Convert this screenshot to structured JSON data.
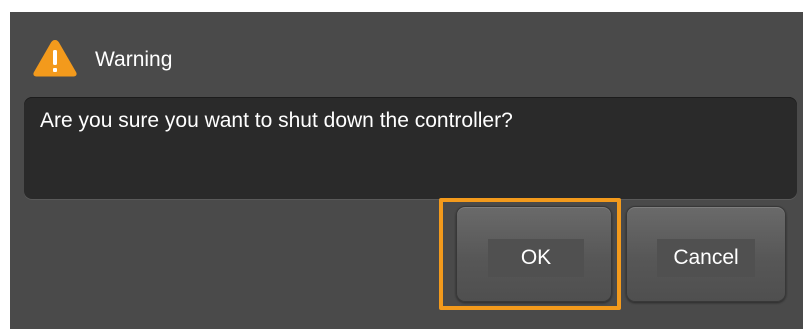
{
  "dialog": {
    "title": "Warning",
    "icon": "warning-triangle-icon",
    "message": "Are you sure you want to shut down the controller?"
  },
  "buttons": {
    "ok_label": "OK",
    "cancel_label": "Cancel",
    "focused": "OK"
  },
  "colors": {
    "dialog_background": "#4a4a4a",
    "message_background": "#2a2a2a",
    "focus_accent": "#f39a1c",
    "warning_icon": "#f39a1c",
    "text": "#ffffff"
  }
}
